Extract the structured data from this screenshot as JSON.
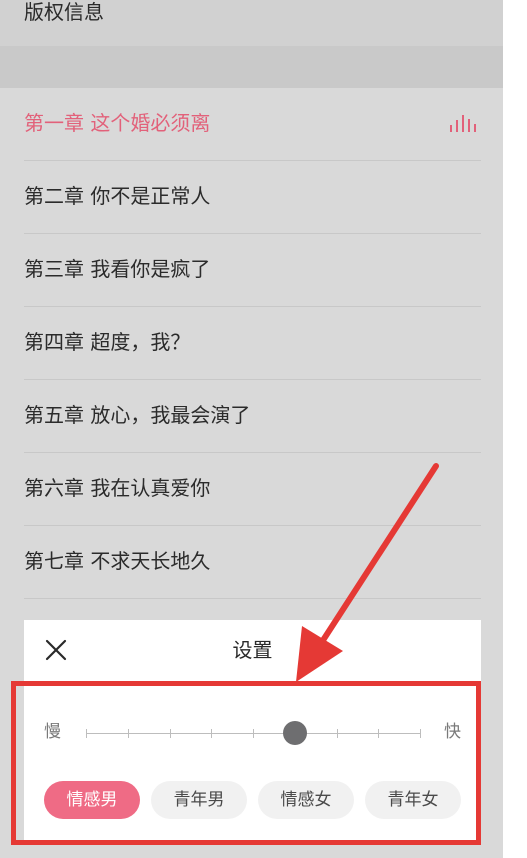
{
  "book": {
    "copyright_label": "版权信息"
  },
  "chapters": [
    {
      "label": "第一章 这个婚必须离",
      "active": true
    },
    {
      "label": "第二章 你不是正常人",
      "active": false
    },
    {
      "label": "第三章 我看你是疯了",
      "active": false
    },
    {
      "label": "第四章 超度，我？",
      "active": false
    },
    {
      "label": "第五章 放心，我最会演了",
      "active": false
    },
    {
      "label": "第六章 我在认真爱你",
      "active": false
    },
    {
      "label": "第七章 不求天长地久",
      "active": false
    }
  ],
  "settings": {
    "title": "设置",
    "speed": {
      "slow_label": "慢",
      "fast_label": "快",
      "steps": 9,
      "selected_step": 5
    },
    "voices": [
      {
        "label": "情感男",
        "selected": true
      },
      {
        "label": "青年男",
        "selected": false
      },
      {
        "label": "情感女",
        "selected": false
      },
      {
        "label": "青年女",
        "selected": false
      }
    ]
  },
  "colors": {
    "accent": "#ef6b85",
    "active_chapter": "#e2617a",
    "annotation": "#e53935",
    "overlay_background": "#d9d9d9"
  },
  "icons": {
    "close": "close-icon",
    "playing": "audio-bars-icon"
  }
}
